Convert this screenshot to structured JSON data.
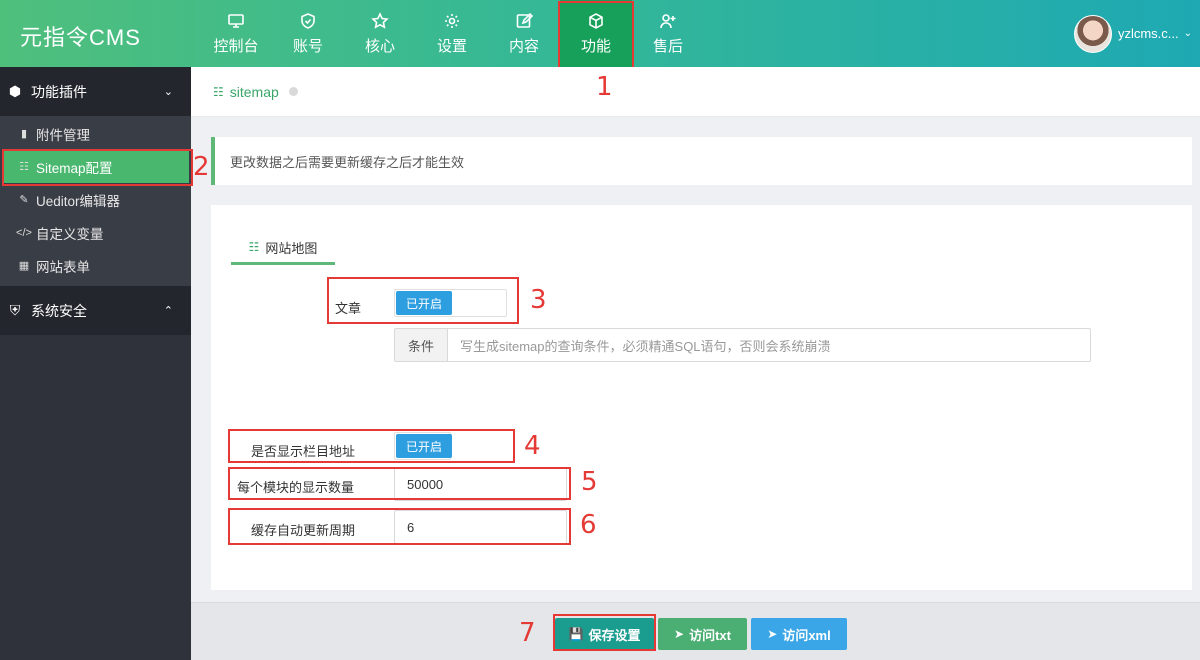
{
  "app": {
    "logo": "元指令CMS"
  },
  "nav": [
    {
      "label": "控制台",
      "icon": "monitor-icon"
    },
    {
      "label": "账号",
      "icon": "shield-icon"
    },
    {
      "label": "核心",
      "icon": "star-icon"
    },
    {
      "label": "设置",
      "icon": "gear-icon"
    },
    {
      "label": "内容",
      "icon": "edit-icon"
    },
    {
      "label": "功能",
      "icon": "cube-icon",
      "active": true
    },
    {
      "label": "售后",
      "icon": "user-plus-icon"
    }
  ],
  "user": {
    "name": "yzlcms.c..."
  },
  "sidebar": {
    "group1": {
      "label": "功能插件",
      "icon": "cube-icon"
    },
    "items": [
      {
        "label": "附件管理",
        "icon": "folder-icon"
      },
      {
        "label": "Sitemap配置",
        "icon": "sitemap-icon",
        "active": true
      },
      {
        "label": "Ueditor编辑器",
        "icon": "edit-icon"
      },
      {
        "label": "自定义变量",
        "icon": "code-icon"
      },
      {
        "label": "网站表单",
        "icon": "table-icon"
      }
    ],
    "group2": {
      "label": "系统安全",
      "icon": "shield-icon"
    }
  },
  "breadcrumb": {
    "label": "sitemap"
  },
  "notice": {
    "text": "更改数据之后需要更新缓存之后才能生效"
  },
  "tab": {
    "label": "网站地图"
  },
  "form": {
    "article": {
      "label": "文章",
      "switch_text": "已开启"
    },
    "condition": {
      "addon": "条件",
      "placeholder": "写生成sitemap的查询条件，必须精通SQL语句，否则会系统崩溃"
    },
    "show_category": {
      "label": "是否显示栏目地址",
      "switch_text": "已开启"
    },
    "per_module": {
      "label": "每个模块的显示数量",
      "value": "50000"
    },
    "cache_cycle": {
      "label": "缓存自动更新周期",
      "value": "6"
    }
  },
  "buttons": {
    "save": "保存设置",
    "visit_txt": "访问txt",
    "visit_xml": "访问xml"
  },
  "annotations": [
    "1",
    "2",
    "3",
    "4",
    "5",
    "6",
    "7"
  ],
  "colors": {
    "accent_green": "#5fb878",
    "switch_blue": "#2d9ee0",
    "annotation_red": "#e53935",
    "btn_teal": "#1a9c8f",
    "btn_green": "#4bae72",
    "btn_blue": "#3aa6e8"
  }
}
